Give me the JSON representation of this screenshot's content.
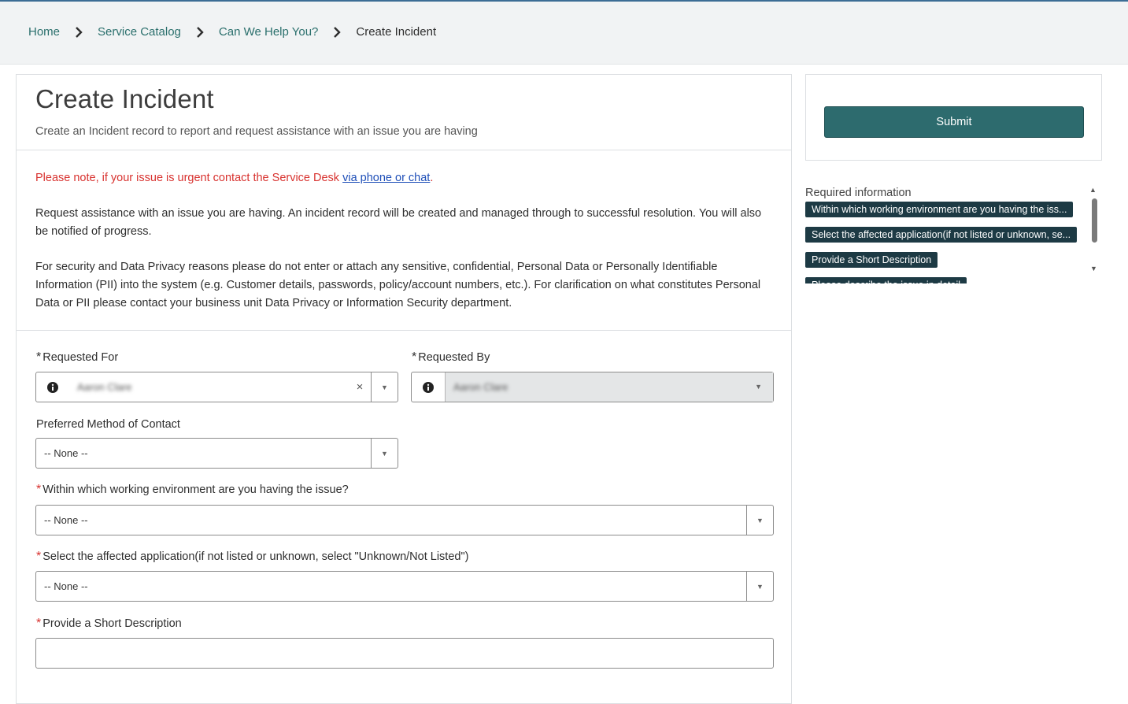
{
  "breadcrumb": {
    "items": [
      "Home",
      "Service Catalog",
      "Can We Help You?"
    ],
    "current": "Create Incident"
  },
  "header": {
    "title": "Create Incident",
    "subtitle": "Create an Incident record to report and request assistance with an issue you are having"
  },
  "notes": {
    "urgent_text": "Please note, if your issue is urgent contact the Service Desk ",
    "urgent_link": "via phone or chat",
    "urgent_end": ".",
    "para1": "Request assistance with an issue you are having. An incident record will be created and managed through to successful resolution. You will also be notified of progress.",
    "para2": "For security and Data Privacy reasons please do not enter or attach any sensitive, confidential, Personal Data or Personally Identifiable Information (PII) into the system (e.g. Customer details, passwords, policy/account numbers, etc.). For clarification on what constitutes Personal Data or PII please contact your business unit Data Privacy or Information Security department."
  },
  "form": {
    "requested_for": {
      "label": "Requested For",
      "value": "Aaron Clare"
    },
    "requested_by": {
      "label": "Requested By",
      "value": "Aaron Clare"
    },
    "preferred_contact": {
      "label": "Preferred Method of Contact",
      "value": "-- None --"
    },
    "working_env": {
      "label": "Within which working environment are you having the issue?",
      "value": "-- None --"
    },
    "affected_app": {
      "label": "Select the affected application(if not listed or unknown, select \"Unknown/Not Listed\")",
      "value": "-- None --"
    },
    "short_desc": {
      "label": "Provide a Short Description",
      "value": ""
    },
    "required_marker": "*"
  },
  "sidebar": {
    "submit_label": "Submit",
    "required_title": "Required information",
    "required_items": [
      "Within which working environment are you having the iss...",
      "Select the affected application(if not listed or unknown, se...",
      "Provide a Short Description",
      "Please describe the issue in detail"
    ]
  },
  "colors": {
    "accent": "#2d6b6e",
    "link": "#2a6f6c",
    "urgent": "#d8322f",
    "pill": "#1d3a44"
  }
}
